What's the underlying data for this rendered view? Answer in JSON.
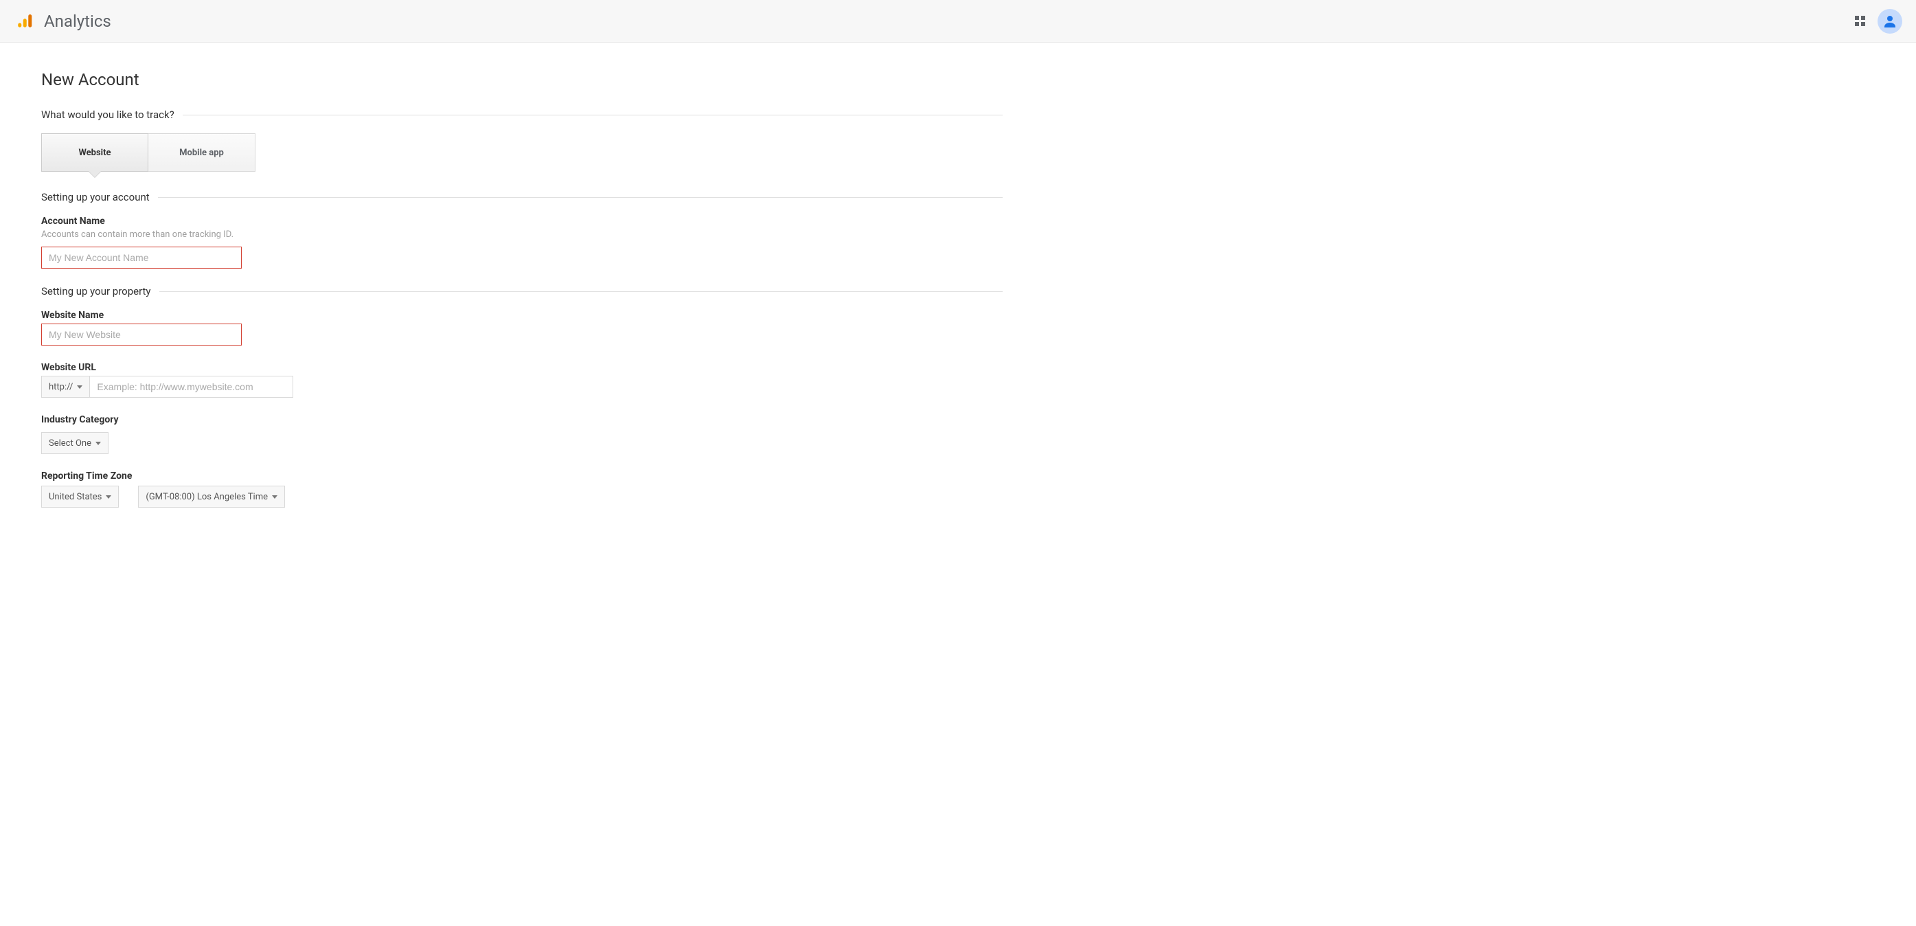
{
  "header": {
    "app_title": "Analytics"
  },
  "page": {
    "title": "New Account",
    "sections": {
      "track": "What would you like to track?",
      "account": "Setting up your account",
      "property": "Setting up your property"
    },
    "tabs": {
      "website": "Website",
      "mobile": "Mobile app"
    },
    "fields": {
      "account_name": {
        "label": "Account Name",
        "hint": "Accounts can contain more than one tracking ID.",
        "placeholder": "My New Account Name"
      },
      "website_name": {
        "label": "Website Name",
        "placeholder": "My New Website"
      },
      "website_url": {
        "label": "Website URL",
        "protocol": "http://",
        "placeholder": "Example: http://www.mywebsite.com"
      },
      "industry": {
        "label": "Industry Category",
        "value": "Select One"
      },
      "timezone": {
        "label": "Reporting Time Zone",
        "country": "United States",
        "zone": "(GMT-08:00) Los Angeles Time"
      }
    }
  }
}
